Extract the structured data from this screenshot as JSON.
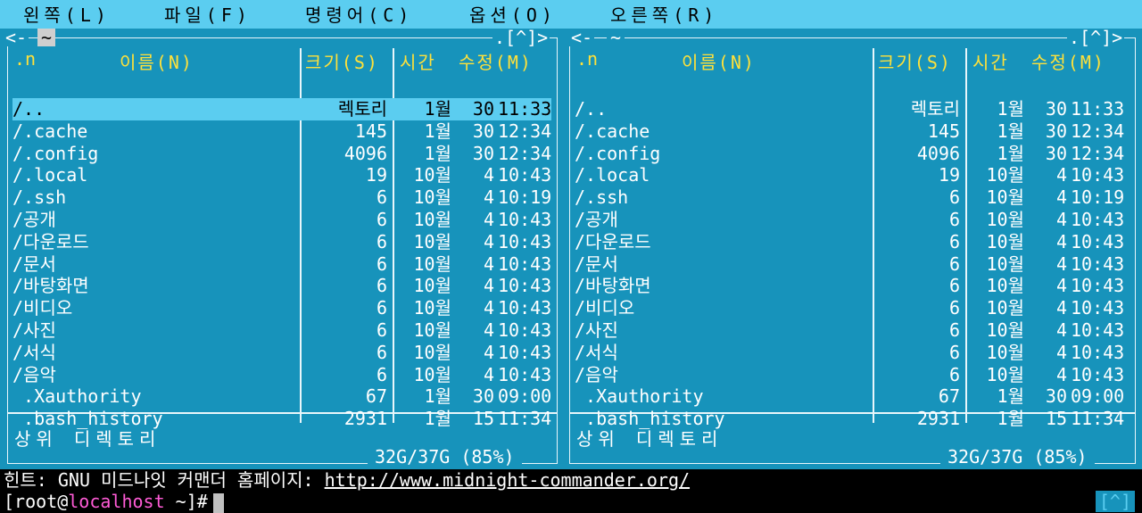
{
  "menu": [
    {
      "label": "왼쪽(L)"
    },
    {
      "label": "파일(F)"
    },
    {
      "label": "명령어(C)"
    },
    {
      "label": "옵션(O)"
    },
    {
      "label": "오른쪽(R)"
    }
  ],
  "panel_controls": {
    "history": "<-",
    "path": "~",
    "right": ".[^]>"
  },
  "columns": {
    "name": "이름(N)",
    "sort_mark": ".n",
    "size": "크기(S)",
    "time": "시간",
    "modified": "수정(M)"
  },
  "files": [
    {
      "name": "/..",
      "size": "렉토리",
      "month": "1월",
      "day": "30",
      "time": "11:33"
    },
    {
      "name": "/.cache",
      "size": "145",
      "month": "1월",
      "day": "30",
      "time": "12:34"
    },
    {
      "name": "/.config",
      "size": "4096",
      "month": "1월",
      "day": "30",
      "time": "12:34"
    },
    {
      "name": "/.local",
      "size": "19",
      "month": "10월",
      "day": "4",
      "time": "10:43"
    },
    {
      "name": "/.ssh",
      "size": "6",
      "month": "10월",
      "day": "4",
      "time": "10:19"
    },
    {
      "name": "/공개",
      "size": "6",
      "month": "10월",
      "day": "4",
      "time": "10:43"
    },
    {
      "name": "/다운로드",
      "size": "6",
      "month": "10월",
      "day": "4",
      "time": "10:43"
    },
    {
      "name": "/문서",
      "size": "6",
      "month": "10월",
      "day": "4",
      "time": "10:43"
    },
    {
      "name": "/바탕화면",
      "size": "6",
      "month": "10월",
      "day": "4",
      "time": "10:43"
    },
    {
      "name": "/비디오",
      "size": "6",
      "month": "10월",
      "day": "4",
      "time": "10:43"
    },
    {
      "name": "/사진",
      "size": "6",
      "month": "10월",
      "day": "4",
      "time": "10:43"
    },
    {
      "name": "/서식",
      "size": "6",
      "month": "10월",
      "day": "4",
      "time": "10:43"
    },
    {
      "name": "/음악",
      "size": "6",
      "month": "10월",
      "day": "4",
      "time": "10:43"
    },
    {
      "name": " .Xauthority",
      "size": "67",
      "month": "1월",
      "day": "30",
      "time": "09:00"
    },
    {
      "name": " .bash_history",
      "size": "2931",
      "month": "1월",
      "day": "15",
      "time": "11:34"
    }
  ],
  "status_text": "상위 디렉토리",
  "disk_usage": "32G/37G (85%)",
  "hint": {
    "prefix": "힌트: GNU 미드나잇 커맨더 홈페이지: ",
    "url": "http://www.midnight-commander.org/"
  },
  "prompt": {
    "open": "[root@",
    "host": "localhost",
    "rest": " ~]#"
  },
  "corner": "[^]",
  "colors": {
    "panel_bg": "#1793bb",
    "menubar_bg": "#5bcdf0",
    "header_text": "#ffe13a",
    "selection_bg": "#5bcdf0",
    "host_text": "#ff5bd6"
  }
}
